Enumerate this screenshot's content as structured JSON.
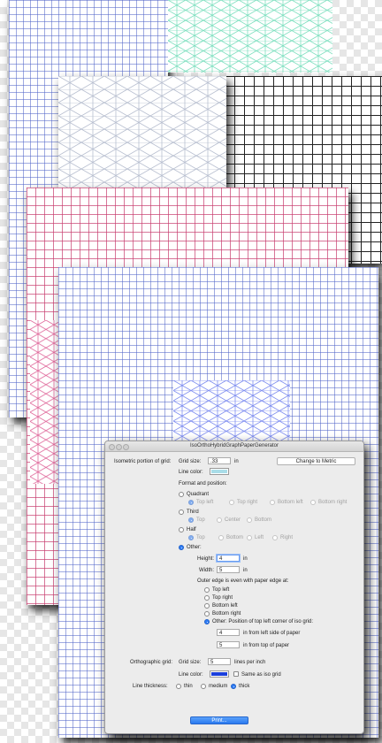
{
  "dialog": {
    "title": "IsoOrthoHybridGraphPaperGenerator",
    "iso_section_label": "Isometric portion of grid:",
    "grid_size_label": "Grid size:",
    "grid_size_value": ".33",
    "grid_size_unit": "in",
    "change_metric_label": "Change to Metric",
    "line_color_label": "Line color:",
    "iso_line_color": "#a9dde8",
    "format_label": "Format and position:",
    "quadrant_label": "Quadrant",
    "quadrant_options": [
      "Top left",
      "Top right",
      "Bottom left",
      "Bottom right"
    ],
    "third_label": "Third",
    "third_options": [
      "Top",
      "Center",
      "Bottom"
    ],
    "half_label": "Half",
    "half_options": [
      "Top",
      "Bottom",
      "Left",
      "Right"
    ],
    "other_label": "Other:",
    "height_label": "Height:",
    "height_value": "4",
    "width_label": "Width:",
    "width_value": "5",
    "dim_unit": "in",
    "outer_edge_label": "Outer edge is even with paper edge at:",
    "edge_options": [
      "Top left",
      "Top right",
      "Bottom left",
      "Bottom right",
      "Other: Position of top left corner of iso grid:"
    ],
    "left_value": "4",
    "left_label": "in from left side of paper",
    "top_value": "5",
    "top_label": "in from top of paper",
    "ortho_section_label": "Orthographic grid:",
    "ortho_grid_size_label": "Grid size:",
    "ortho_grid_size_value": "5",
    "ortho_grid_unit": "lines per inch",
    "ortho_line_color_label": "Line color:",
    "ortho_line_color": "#1a3fdc",
    "same_as_iso_label": "Same as iso grid",
    "thickness_label": "Line thickness:",
    "thickness_options": [
      "thin",
      "medium",
      "thick"
    ],
    "print_label": "Print..."
  },
  "colors": {
    "iso_green": "#7fe0c0",
    "iso_gray": "#b8bfd0",
    "iso_pink": "#e06a9c",
    "iso_blue": "#7f8ef0",
    "grid_blue": "#5064c8",
    "grid_black": "#222222",
    "grid_pink": "#c83c6e"
  }
}
